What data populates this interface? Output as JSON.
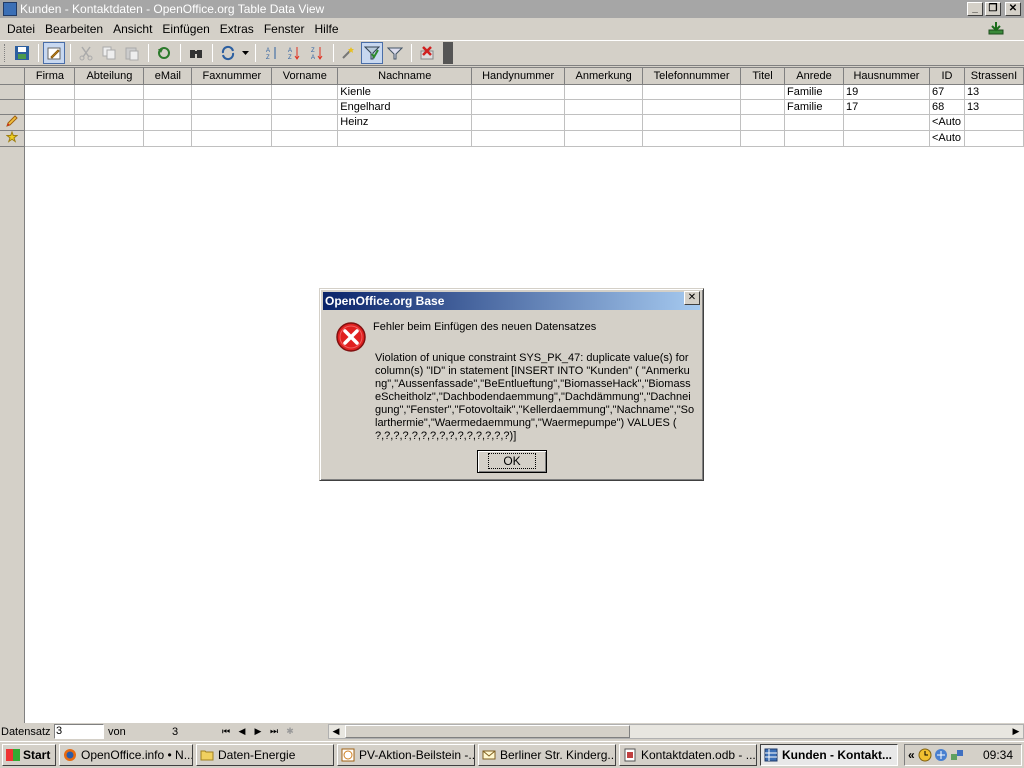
{
  "window": {
    "title": "Kunden - Kontaktdaten - OpenOffice.org Table Data View"
  },
  "menu": [
    {
      "label": "Datei"
    },
    {
      "label": "Bearbeiten"
    },
    {
      "label": "Ansicht"
    },
    {
      "label": "Einfügen"
    },
    {
      "label": "Extras"
    },
    {
      "label": "Fenster"
    },
    {
      "label": "Hilfe"
    }
  ],
  "toolbar": {
    "icons": [
      "save-record-icon",
      "edit-data-icon",
      "cut-icon",
      "copy-icon",
      "paste-icon",
      "undo-icon",
      "find-record-icon",
      "refresh-icon",
      "sort-ascending-icon",
      "sort-descending-icon",
      "sort-icon",
      "autofilter-icon",
      "apply-filter-icon",
      "standard-filter-icon",
      "delete-record-icon"
    ]
  },
  "table": {
    "columns": [
      "Firma",
      "Abteilung",
      "eMail",
      "Faxnummer",
      "Vorname",
      "Nachname",
      "Handynummer",
      "Anmerkung",
      "Telefonnummer",
      "Titel",
      "Anrede",
      "Hausnummer",
      "ID",
      "StrassenI"
    ],
    "rows": [
      {
        "marker": "",
        "cells": [
          "",
          "",
          "",
          "",
          "",
          "Kienle",
          "",
          "",
          "",
          "",
          "Familie",
          "19",
          "67",
          "13"
        ]
      },
      {
        "marker": "",
        "cells": [
          "",
          "",
          "",
          "",
          "",
          "Engelhard",
          "",
          "",
          "",
          "",
          "Familie",
          "17",
          "68",
          "13"
        ]
      },
      {
        "marker": "pencil-icon",
        "cells": [
          "",
          "",
          "",
          "",
          "",
          "Heinz",
          "",
          "",
          "",
          "",
          "",
          "",
          "<Auto",
          ""
        ]
      },
      {
        "marker": "new-record-icon",
        "cells": [
          "",
          "",
          "",
          "",
          "",
          "",
          "",
          "",
          "",
          "",
          "",
          "",
          "<Auto",
          ""
        ]
      }
    ]
  },
  "navigation": {
    "record_label": "Datensatz",
    "record_value": "3",
    "of_label": "von",
    "total": "3"
  },
  "dialog": {
    "title": "OpenOffice.org Base",
    "heading": "Fehler beim Einfügen des neuen Datensatzes",
    "message": "Violation of unique constraint SYS_PK_47: duplicate value(s) for column(s) \"ID\" in statement [INSERT INTO \"Kunden\" ( \"Anmerkung\",\"Aussenfassade\",\"BeEntlueftung\",\"BiomasseHack\",\"BiomasseScheitholz\",\"Dachbodendaemmung\",\"Dachdämmung\",\"Dachneigung\",\"Fenster\",\"Fotovoltaik\",\"Kellerdaemmung\",\"Nachname\",\"Solarthermie\",\"Waermedaemmung\",\"Waermepumpe\") VALUES ( ?,?,?,?,?,?,?,?,?,?,?,?,?,?,?)]",
    "ok_label": "OK"
  },
  "taskbar": {
    "start_label": "Start",
    "tasks": [
      {
        "label": "OpenOffice.info • N...",
        "icon": "firefox-icon",
        "active": false
      },
      {
        "label": "Daten-Energie",
        "icon": "folder-icon",
        "active": false
      },
      {
        "label": "PV-Aktion-Beilstein -...",
        "icon": "calendar-icon",
        "active": false
      },
      {
        "label": "Berliner Str. Kinderg...",
        "icon": "mail-icon",
        "active": false
      },
      {
        "label": "Kontaktdaten.odb - ...",
        "icon": "base-document-icon",
        "active": false
      },
      {
        "label": "Kunden - Kontakt...",
        "icon": "base-table-icon",
        "active": true
      }
    ],
    "clock": "09:34"
  }
}
